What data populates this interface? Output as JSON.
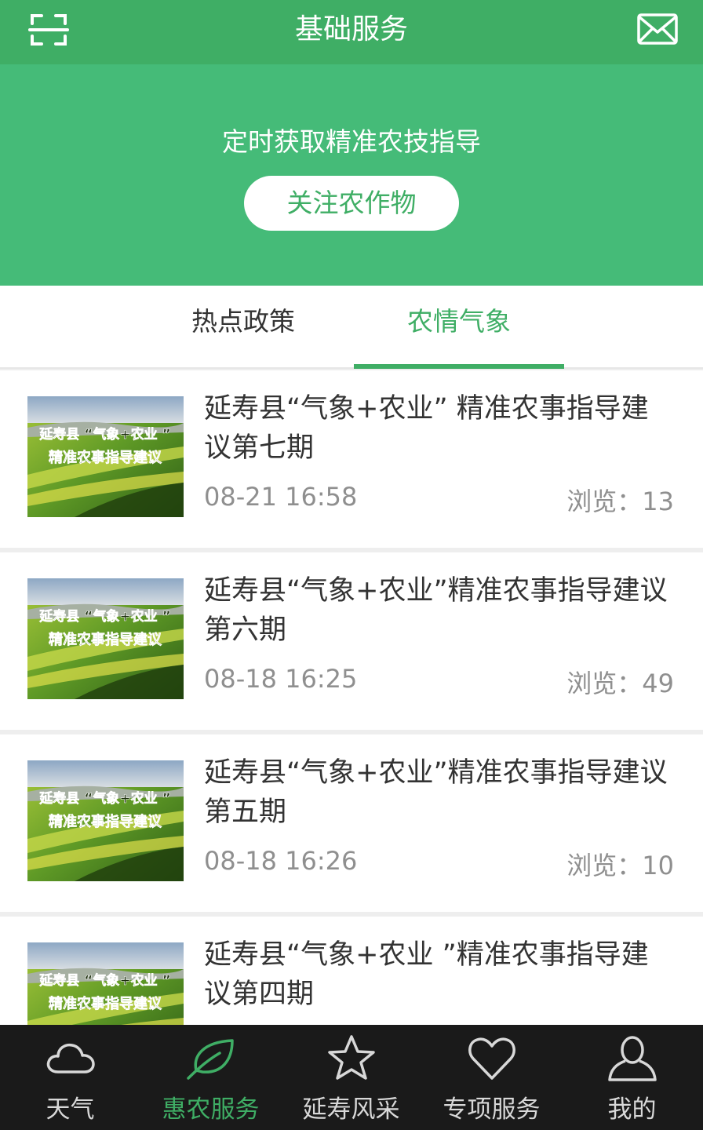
{
  "header": {
    "title": "基础服务",
    "left_icon": "scan-icon",
    "right_icon": "mail-icon"
  },
  "banner": {
    "tagline": "定时获取精准农技指导",
    "button_label": "关注农作物"
  },
  "tabs": [
    {
      "label": "热点政策",
      "active": false
    },
    {
      "label": "农情气象",
      "active": true
    }
  ],
  "thumbnail_text": {
    "line1": "延寿县 “气象+农业 ”",
    "line2": "精准农事指导建议"
  },
  "articles": [
    {
      "title": "延寿县“气象+农业” 精准农事指导建议第七期",
      "time": "08-21 16:58",
      "views": "浏览：13"
    },
    {
      "title": "延寿县“气象+农业”精准农事指导建议第六期",
      "time": "08-18 16:25",
      "views": "浏览：49"
    },
    {
      "title": "延寿县“气象+农业”精准农事指导建议第五期",
      "time": "08-18 16:26",
      "views": "浏览：10"
    },
    {
      "title": "延寿县“气象+农业 ”精准农事指导建议第四期",
      "time": "",
      "views": ""
    }
  ],
  "bottom_nav": [
    {
      "label": "天气",
      "icon": "cloud-icon",
      "active": false
    },
    {
      "label": "惠农服务",
      "icon": "leaf-icon",
      "active": true
    },
    {
      "label": "延寿风采",
      "icon": "star-icon",
      "active": false
    },
    {
      "label": "专项服务",
      "icon": "heart-icon",
      "active": false
    },
    {
      "label": "我的",
      "icon": "user-icon",
      "active": false
    }
  ],
  "colors": {
    "header": "#3fae65",
    "banner": "#45bb78",
    "accent": "#3fae65",
    "nav_background": "#1a1a1a"
  }
}
